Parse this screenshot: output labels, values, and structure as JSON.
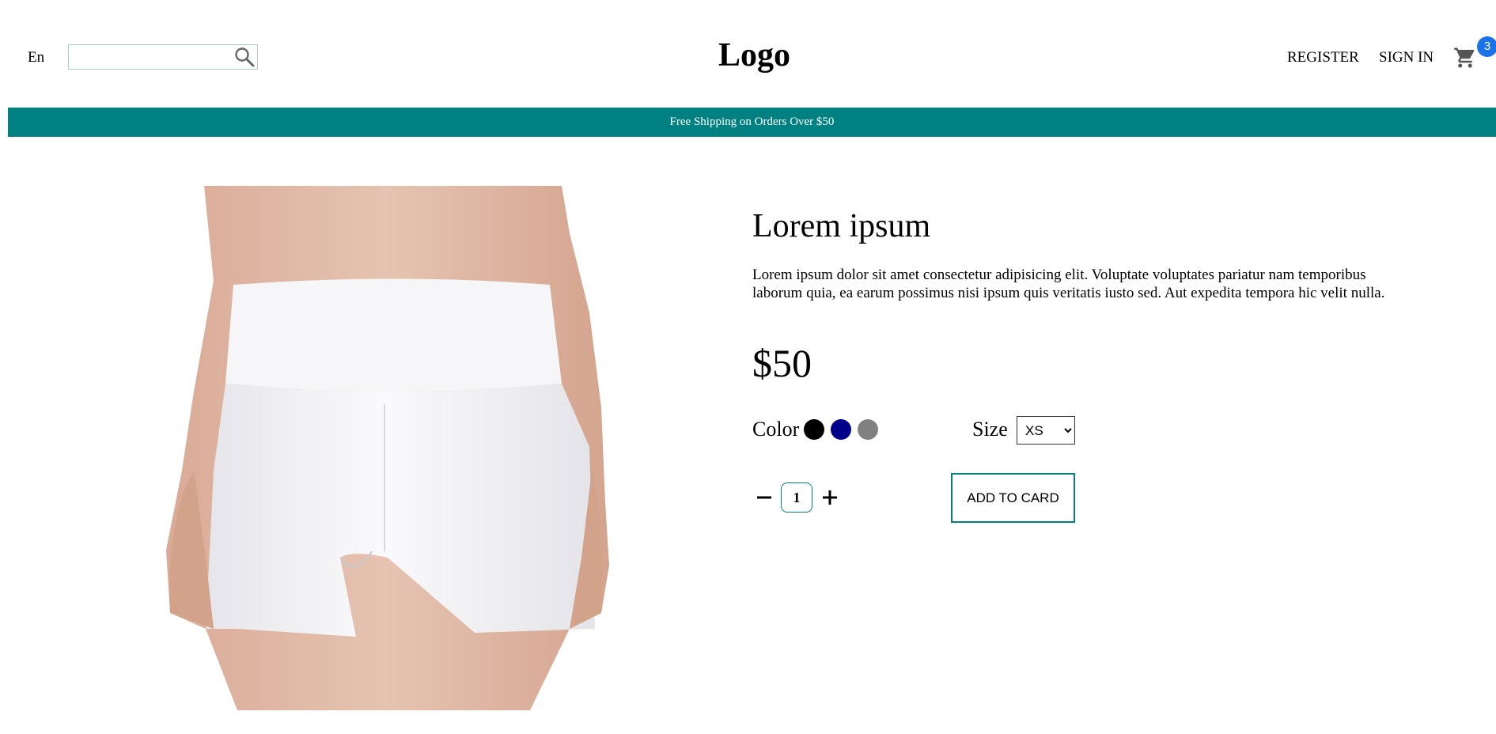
{
  "header": {
    "language": "En",
    "search": {
      "value": "",
      "placeholder": ""
    },
    "logo": "Logo",
    "register_label": "REGISTER",
    "signin_label": "SIGN IN",
    "cart_count": "3"
  },
  "banner": {
    "text": "Free Shipping on Orders Over $50"
  },
  "product": {
    "title": "Lorem ipsum",
    "description": "Lorem ipsum dolor sit amet consectetur adipisicing elit. Voluptate voluptates pariatur nam temporibus laborum quia, ea earum possimus nisi ipsum quis veritatis iusto sed. Aut expedita tempora hic velit nulla.",
    "price": "$50",
    "color_label": "Color",
    "colors": [
      "#000000",
      "#00008b",
      "#808080"
    ],
    "size_label": "Size",
    "size_selected": "XS",
    "quantity": "1",
    "add_button_label": "ADD TO CARD"
  },
  "colors": {
    "accent": "#008080",
    "badge": "#1a73e8"
  },
  "icons": [
    "search-icon",
    "cart-icon",
    "minus-icon",
    "plus-icon",
    "chevron-down-icon"
  ]
}
